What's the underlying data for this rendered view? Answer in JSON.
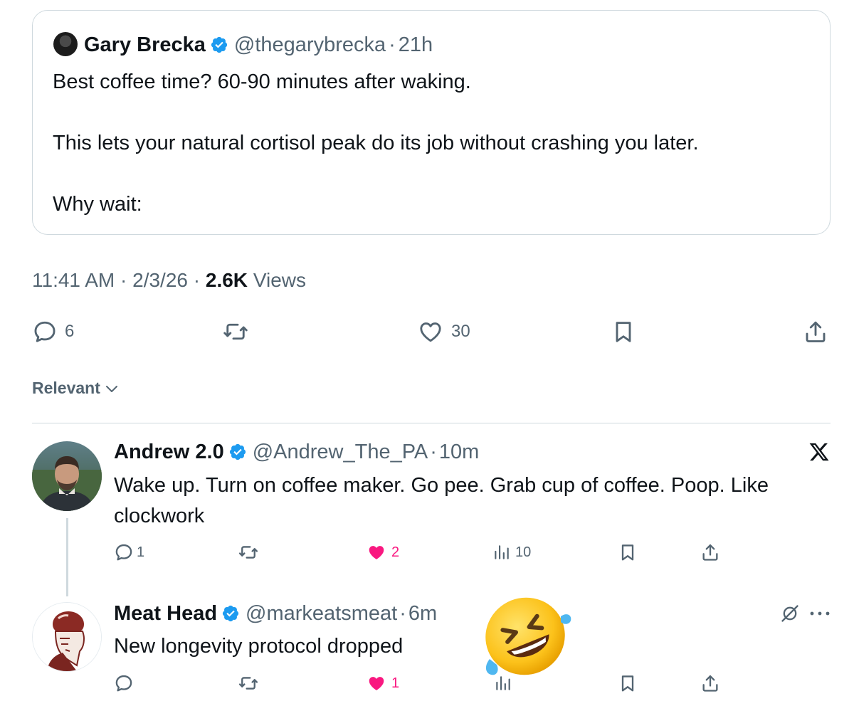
{
  "quoted_tweet": {
    "author_name": "Gary Brecka",
    "handle": "@thegarybrecka",
    "time": "21h",
    "lines": [
      "Best coffee time? 60-90 minutes after waking.",
      "This lets your natural cortisol peak do its job without crashing you later.",
      "Why wait:"
    ]
  },
  "post_meta": {
    "time": "11:41 AM",
    "date": "2/3/26",
    "views_count": "2.6K",
    "views_label": "Views"
  },
  "main_actions": {
    "replies": "6",
    "likes": "30"
  },
  "sort": {
    "label": "Relevant"
  },
  "replies": [
    {
      "author_name": "Andrew 2.0",
      "handle": "@Andrew_The_PA",
      "time": "10m",
      "lines": [
        "Wake up. Turn on coffee maker. Go pee. Grab cup of coffee. Poop. Like",
        "clockwork"
      ],
      "replies": "1",
      "likes": "2",
      "views": "10"
    },
    {
      "author_name": "Meat Head",
      "handle": "@markeatsmeat",
      "time": "6m",
      "lines": [
        "New longevity protocol dropped"
      ],
      "likes": "1",
      "overlay_emoji": "🤣"
    }
  ],
  "colors": {
    "text": "#0f1419",
    "secondary": "#536471",
    "verified": "#1d9bf0",
    "like_active": "#f91880",
    "border": "#cfd9de"
  },
  "icons": [
    "verified-badge-icon",
    "reply-icon",
    "repost-icon",
    "like-icon",
    "bookmark-icon",
    "share-icon",
    "views-icon",
    "x-logo-icon",
    "chevron-down-icon",
    "more-icon",
    "mute-icon"
  ]
}
